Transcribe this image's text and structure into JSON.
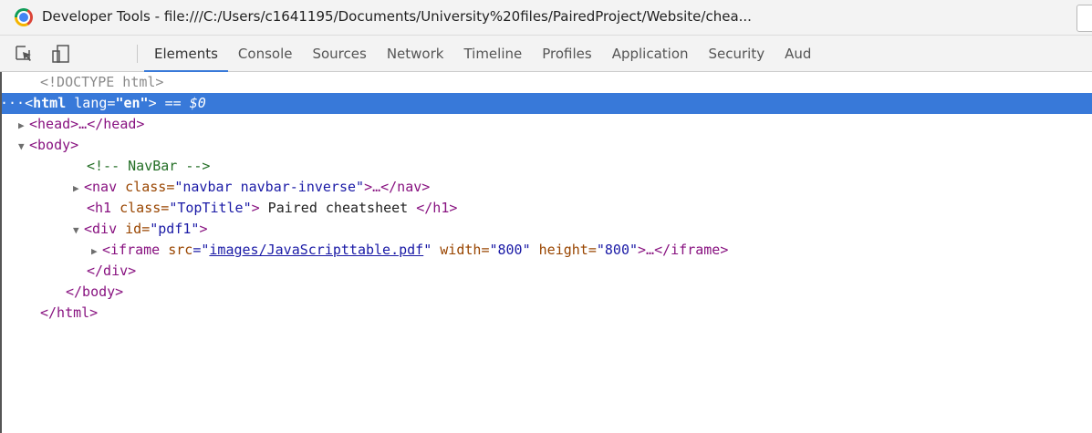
{
  "window": {
    "title": "Developer Tools - file:///C:/Users/c1641195/Documents/University%20files/PairedProject/Website/chea..."
  },
  "toolbar": {
    "icons": [
      "inspect-element-icon",
      "device-mode-icon"
    ],
    "tabs": [
      {
        "label": "Elements",
        "active": true
      },
      {
        "label": "Console"
      },
      {
        "label": "Sources"
      },
      {
        "label": "Network"
      },
      {
        "label": "Timeline"
      },
      {
        "label": "Profiles"
      },
      {
        "label": "Application"
      },
      {
        "label": "Security"
      },
      {
        "label": "Aud"
      }
    ]
  },
  "dom": {
    "doctype": "<!DOCTYPE html>",
    "html_open": {
      "ellipsis": "···",
      "tag_open": "<",
      "tag": "html",
      "attr_name": " lang",
      "attr_eq": "=",
      "attr_value": "\"en\"",
      "tag_close": ">",
      "selected_marker": " == $0"
    },
    "head": {
      "tri": "▶",
      "text": "<head>…</head>"
    },
    "body_open": {
      "tri": "▼",
      "text": "<body>"
    },
    "comment": "<!-- NavBar -->",
    "nav": {
      "tri": "▶",
      "tag_open": "<nav",
      "attr_name": " class",
      "attr_eq": "=",
      "attr_value": "\"navbar navbar-inverse\"",
      "tag_end": ">…</nav>"
    },
    "h1": {
      "tag_open": "<h1",
      "attr_name": " class",
      "attr_eq": "=",
      "attr_value": "\"TopTitle\"",
      "tag_gt": ">",
      "text": " Paired cheatsheet ",
      "tag_end": "</h1>"
    },
    "div_open": {
      "tri": "▼",
      "tag_open": "<div",
      "attr_name": " id",
      "attr_eq": "=",
      "attr_value": "\"pdf1\"",
      "tag_gt": ">"
    },
    "iframe": {
      "tri": "▶",
      "tag_open": "<iframe",
      "src_name": " src",
      "src_eq": "=\"",
      "src_value": "images/JavaScripttable.pdf",
      "src_close": "\"",
      "width_name": " width",
      "width_eq": "=",
      "width_value": "\"800\"",
      "height_name": " height",
      "height_eq": "=",
      "height_value": "\"800\"",
      "tag_end": ">…</iframe>"
    },
    "div_close": "</div>",
    "body_close": "</body>",
    "html_close": "</html>"
  }
}
